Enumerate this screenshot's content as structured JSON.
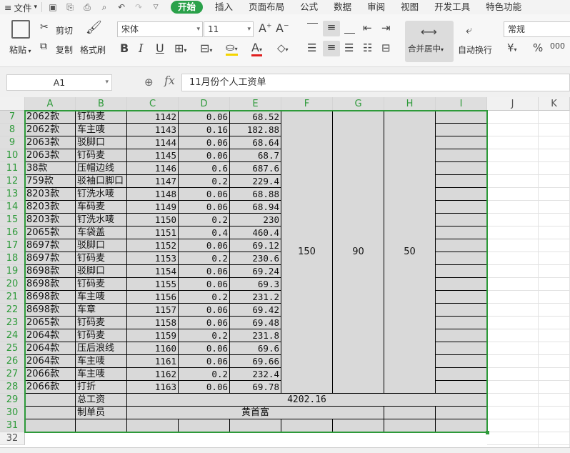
{
  "menu": {
    "file_label": "文件",
    "tabs": [
      "开始",
      "插入",
      "页面布局",
      "公式",
      "数据",
      "审阅",
      "视图",
      "开发工具",
      "特色功能"
    ],
    "active_tab": "开始"
  },
  "ribbon": {
    "paste": "粘贴",
    "cut": "剪切",
    "copy": "复制",
    "format_painter": "格式刷",
    "font_name": "宋体",
    "font_size": "11",
    "merge_center": "合并居中",
    "wrap_text": "自动换行",
    "number_format": "常规",
    "currency_symbol": "¥",
    "percent_symbol": "%",
    "thousands_symbol": "000"
  },
  "formula_bar": {
    "cell_ref": "A1",
    "fx_label": "fx",
    "content": "11月份个人工资单"
  },
  "columns": [
    "A",
    "B",
    "C",
    "D",
    "E",
    "F",
    "G",
    "H",
    "I",
    "J",
    "K"
  ],
  "rows": [
    {
      "n": "7",
      "a": "2062款",
      "b": "钉码麦",
      "c": "1142",
      "d": "0.06",
      "e": "68.52"
    },
    {
      "n": "8",
      "a": "2062款",
      "b": "车主唛",
      "c": "1143",
      "d": "0.16",
      "e": "182.88"
    },
    {
      "n": "9",
      "a": "2063款",
      "b": "驳脚口",
      "c": "1144",
      "d": "0.06",
      "e": "68.64"
    },
    {
      "n": "10",
      "a": "2063款",
      "b": "钉码麦",
      "c": "1145",
      "d": "0.06",
      "e": "68.7"
    },
    {
      "n": "11",
      "a": "38款",
      "b": "压帽边线",
      "c": "1146",
      "d": "0.6",
      "e": "687.6"
    },
    {
      "n": "12",
      "a": "759款",
      "b": "驳袖口脚口",
      "c": "1147",
      "d": "0.2",
      "e": "229.4"
    },
    {
      "n": "13",
      "a": "8203款",
      "b": "钉洗水唛",
      "c": "1148",
      "d": "0.06",
      "e": "68.88"
    },
    {
      "n": "14",
      "a": "8203款",
      "b": "车码麦",
      "c": "1149",
      "d": "0.06",
      "e": "68.94"
    },
    {
      "n": "15",
      "a": "8203款",
      "b": "钉洗水唛",
      "c": "1150",
      "d": "0.2",
      "e": "230"
    },
    {
      "n": "16",
      "a": "2065款",
      "b": "车袋盖",
      "c": "1151",
      "d": "0.4",
      "e": "460.4"
    },
    {
      "n": "17",
      "a": "8697款",
      "b": "驳脚口",
      "c": "1152",
      "d": "0.06",
      "e": "69.12"
    },
    {
      "n": "18",
      "a": "8697款",
      "b": "钉码麦",
      "c": "1153",
      "d": "0.2",
      "e": "230.6"
    },
    {
      "n": "19",
      "a": "8698款",
      "b": "驳脚口",
      "c": "1154",
      "d": "0.06",
      "e": "69.24"
    },
    {
      "n": "20",
      "a": "8698款",
      "b": "钉码麦",
      "c": "1155",
      "d": "0.06",
      "e": "69.3"
    },
    {
      "n": "21",
      "a": "8698款",
      "b": "车主唛",
      "c": "1156",
      "d": "0.2",
      "e": "231.2"
    },
    {
      "n": "22",
      "a": "8698款",
      "b": "车章",
      "c": "1157",
      "d": "0.06",
      "e": "69.42"
    },
    {
      "n": "23",
      "a": "2065款",
      "b": "钉码麦",
      "c": "1158",
      "d": "0.06",
      "e": "69.48"
    },
    {
      "n": "24",
      "a": "2064款",
      "b": "钉码麦",
      "c": "1159",
      "d": "0.2",
      "e": "231.8"
    },
    {
      "n": "25",
      "a": "2064款",
      "b": "压后浪线",
      "c": "1160",
      "d": "0.06",
      "e": "69.6"
    },
    {
      "n": "26",
      "a": "2064款",
      "b": "车主唛",
      "c": "1161",
      "d": "0.06",
      "e": "69.66"
    },
    {
      "n": "27",
      "a": "2066款",
      "b": "车主唛",
      "c": "1162",
      "d": "0.2",
      "e": "232.4"
    },
    {
      "n": "28",
      "a": "2066款",
      "b": "打折",
      "c": "1163",
      "d": "0.06",
      "e": "69.78"
    }
  ],
  "merged": {
    "f": "150",
    "g": "90",
    "h": "50"
  },
  "total_row": {
    "n": "29",
    "label": "总工资",
    "value": "4202.16"
  },
  "maker_row": {
    "n": "30",
    "label": "制单员",
    "value": "黄首富"
  },
  "extra_rows": [
    "31",
    "32"
  ]
}
